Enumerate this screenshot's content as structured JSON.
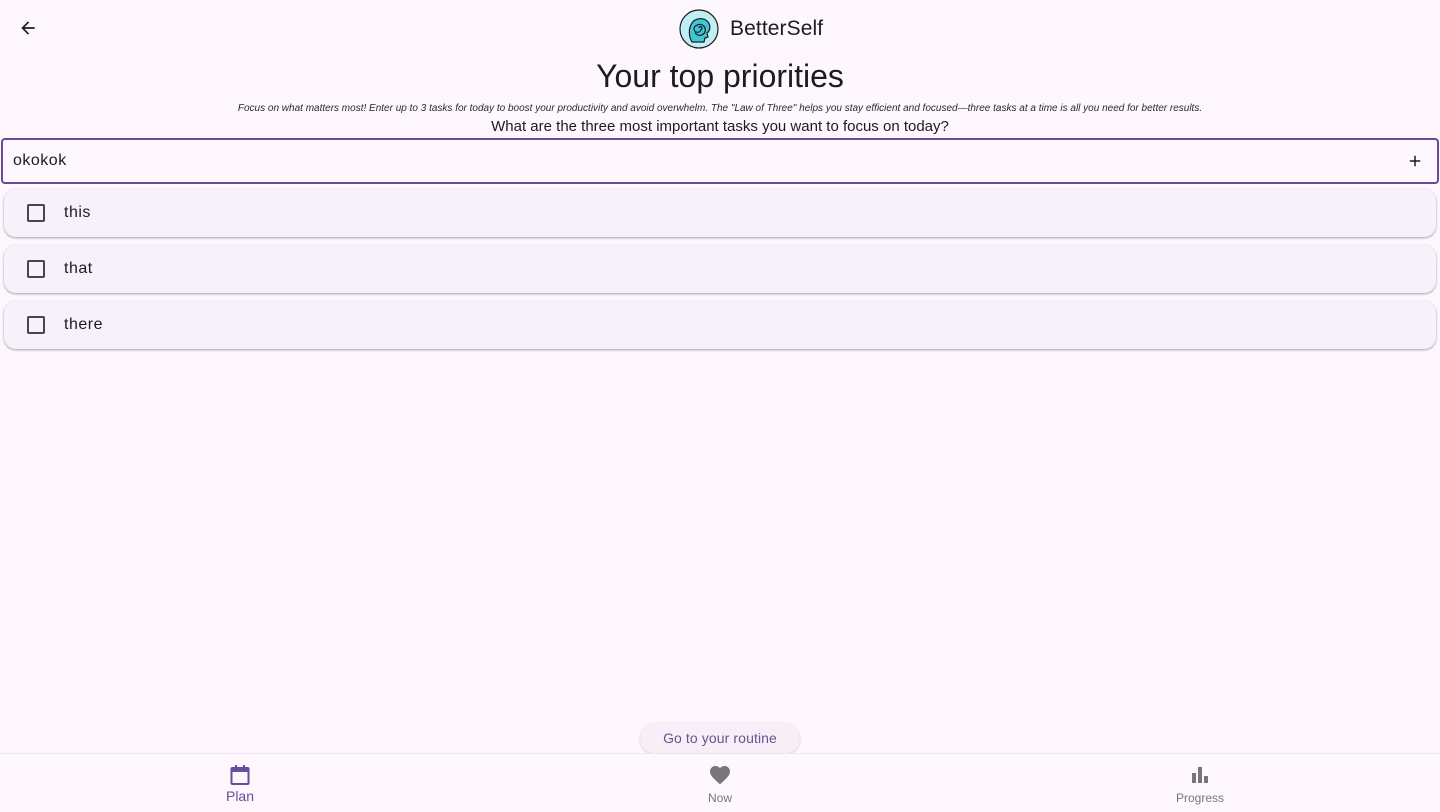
{
  "header": {
    "back_icon": "arrow-left-icon",
    "logo_icon": "head-spiral-icon",
    "app_name": "BetterSelf"
  },
  "main": {
    "title": "Your top priorities",
    "intro": "Focus on what matters most! Enter up to 3 tasks for today to boost your productivity and avoid overwhelm. The \"Law of Three\" helps you stay efficient and focused—three tasks at a time is all you need for better results.",
    "question": "What are the three most important tasks you want to focus on today?",
    "task_input": {
      "value": "okokok",
      "add_icon": "plus-icon"
    },
    "tasks": [
      {
        "label": "this",
        "checked": false
      },
      {
        "label": "that",
        "checked": false
      },
      {
        "label": "there",
        "checked": false
      }
    ],
    "routine_button": "Go to your routine"
  },
  "bottom_nav": {
    "items": [
      {
        "label": "Plan",
        "icon": "calendar-icon",
        "active": true
      },
      {
        "label": "Now",
        "icon": "heart-icon",
        "active": false
      },
      {
        "label": "Progress",
        "icon": "bar-chart-icon",
        "active": false
      }
    ]
  },
  "colors": {
    "background": "#fff7fe",
    "accent": "#6a4a99",
    "card": "#f7f1fb",
    "muted": "#79747e"
  }
}
